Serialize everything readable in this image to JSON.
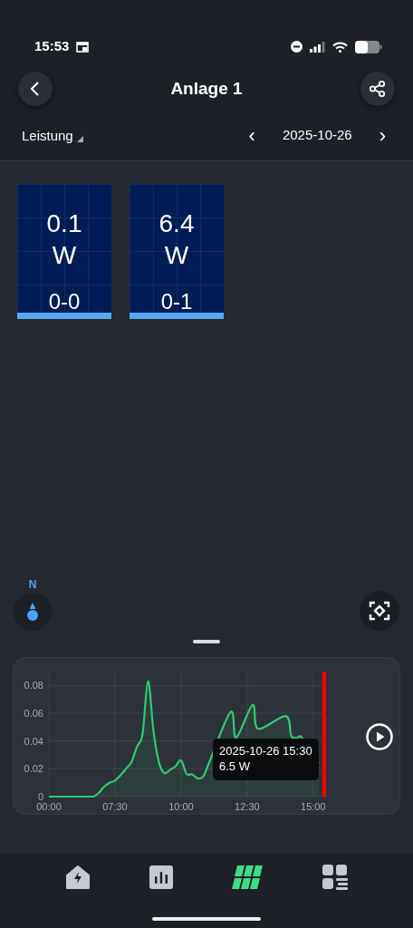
{
  "status_bar": {
    "time": "15:53"
  },
  "header": {
    "title": "Anlage 1"
  },
  "toolbar": {
    "metric": "Leistung",
    "date": "2025-10-26",
    "prev": "‹",
    "next": "›"
  },
  "tiles": [
    {
      "value": "0.1",
      "unit": "W",
      "label": "0-0"
    },
    {
      "value": "6.4",
      "unit": "W",
      "label": "0-1"
    }
  ],
  "compass": {
    "label": "N"
  },
  "chart": {
    "tooltip": [
      "2025-10-26 15:30",
      "6.5 W"
    ],
    "chart_data": {
      "type": "area",
      "categories": [
        "00:00",
        null,
        null,
        null,
        null,
        null,
        null,
        null,
        null,
        null,
        null,
        null,
        "07:30",
        null,
        null,
        null,
        null,
        null,
        null,
        null,
        null,
        null,
        null,
        null,
        "10:00",
        null,
        null,
        null,
        null,
        null,
        null,
        null,
        null,
        null,
        null,
        null,
        "12:30",
        null,
        null,
        null,
        null,
        null,
        null,
        null,
        null,
        null,
        null,
        null,
        "15:00",
        null,
        null
      ],
      "series": [
        {
          "color": "#2ecc71",
          "values": [
            0,
            0,
            0,
            0,
            0,
            0,
            0,
            0,
            0,
            0.0024,
            0.007,
            0.0099,
            0.0115,
            0.0154,
            0.02,
            0.025,
            0.036,
            0.045,
            0.083,
            0.047,
            0.0244,
            0.0168,
            0.0193,
            0.0218,
            0.026,
            0.0164,
            0.016,
            0.0132,
            0.0144,
            0.0235,
            null,
            null,
            null,
            0.061,
            0.0424,
            null,
            null,
            0.066,
            0.0487,
            null,
            null,
            null,
            null,
            0.058,
            0.0439,
            0.0422,
            0.0421,
            null,
            null,
            0.0238,
            null
          ]
        }
      ],
      "grid": true,
      "ylim": [
        0,
        0.09
      ],
      "yticks": [
        {
          "value": 0,
          "label": "0"
        },
        {
          "value": 0.02,
          "label": "0.02"
        },
        {
          "value": 0.04,
          "label": "0.04"
        },
        {
          "value": 0.06,
          "label": "0.06"
        },
        {
          "value": 0.08,
          "label": "0.08"
        }
      ]
    }
  },
  "bottom_nav": [
    {
      "kind": "home",
      "selected": false
    },
    {
      "kind": "stats",
      "selected": false
    },
    {
      "kind": "panels",
      "selected": true
    },
    {
      "kind": "dashboard",
      "selected": false
    }
  ]
}
